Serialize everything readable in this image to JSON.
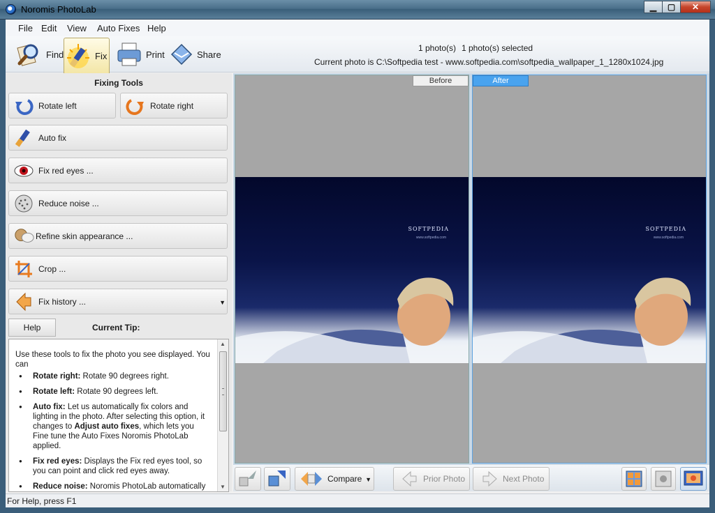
{
  "window": {
    "title": "Noromis PhotoLab"
  },
  "menu": [
    "File",
    "Edit",
    "View",
    "Auto Fixes",
    "Help"
  ],
  "toolbar": {
    "find": "Find",
    "fix": "Fix",
    "print": "Print",
    "share": "Share",
    "photo_count": "1 photo(s)",
    "selected_count": "1 photo(s) selected",
    "current_photo": "Current photo is  C:\\Softpedia test - www.softpedia.com\\softpedia_wallpaper_1_1280x1024.jpg"
  },
  "fixing_tools": {
    "title": "Fixing Tools",
    "rotate_left": "Rotate left",
    "rotate_right": "Rotate right",
    "auto_fix": "Auto fix",
    "fix_red_eyes": "Fix red eyes ...",
    "reduce_noise": "Reduce noise ...",
    "refine_skin": "Refine skin appearance ...",
    "crop": "Crop ...",
    "fix_history": "Fix history ..."
  },
  "tip": {
    "help_label": "Help",
    "title": "Current Tip:",
    "intro": "Use these tools to fix the photo you see displayed. You can",
    "items": [
      {
        "term": "Rotate right:",
        "text": " Rotate 90 degrees right."
      },
      {
        "term": "Rotate left:",
        "text": " Rotate 90 degrees left."
      },
      {
        "term": "Auto fix:",
        "text": " Let us automatically fix colors and lighting in the photo. After selecting this option, it changes to ",
        "term2": "Adjust auto fixes",
        "text2": ", which lets you Fine tune the Auto Fixes Noromis PhotoLab applied."
      },
      {
        "term": "Fix red eyes:",
        "text": " Displays the Fix red eyes tool, so you can point and click red eyes away."
      },
      {
        "term": "Reduce noise:",
        "text": " Noromis PhotoLab automatically detects and  removes digital noise."
      }
    ]
  },
  "viewer": {
    "before_label": "Before",
    "after_label": "After",
    "photo_brand": "SOFTPEDIA",
    "photo_sub": "www.softpedia.com"
  },
  "bottom": {
    "compare": "Compare",
    "prior_photo": "Prior Photo",
    "next_photo": "Next Photo"
  },
  "status": {
    "text": "For Help, press F1"
  }
}
